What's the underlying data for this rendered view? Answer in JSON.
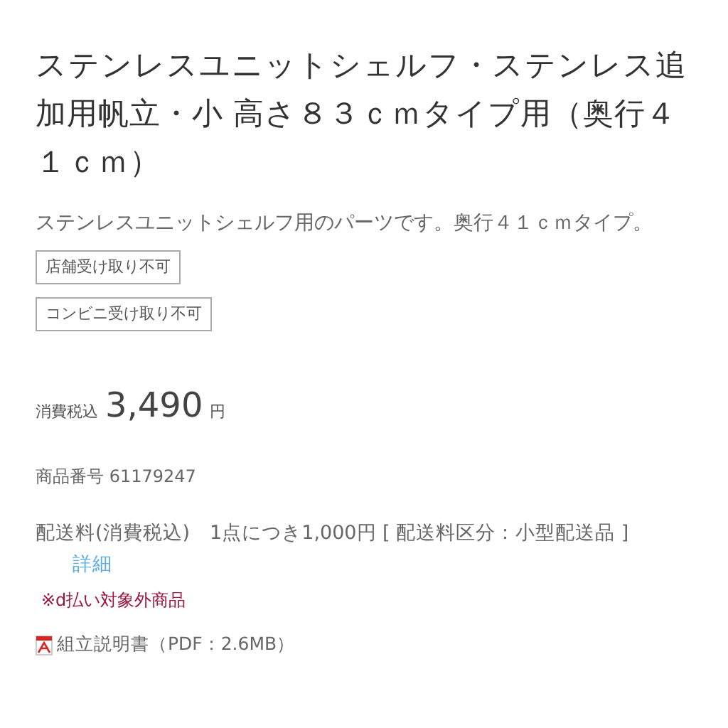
{
  "title": "ステンレスユニットシェルフ・ステンレス追加用帆立・小 高さ８３ｃｍタイプ用（奥行４１ｃｍ）",
  "description": "ステンレスユニットシェルフ用のパーツです。奥行４１ｃｍタイプ。",
  "tags": [
    "店舗受け取り不可",
    "コンビニ受け取り不可"
  ],
  "price": {
    "label": "消費税込",
    "amount": "3,490",
    "unit": "円"
  },
  "product_number": "商品番号 61179247",
  "shipping": {
    "text": "配送料(消費税込)　1点につき1,000円 [ 配送料区分：小型配送品 ]",
    "link": "詳細"
  },
  "notice": "※d払い対象外商品",
  "manual": "組立説明書（PDF：2.6MB）"
}
